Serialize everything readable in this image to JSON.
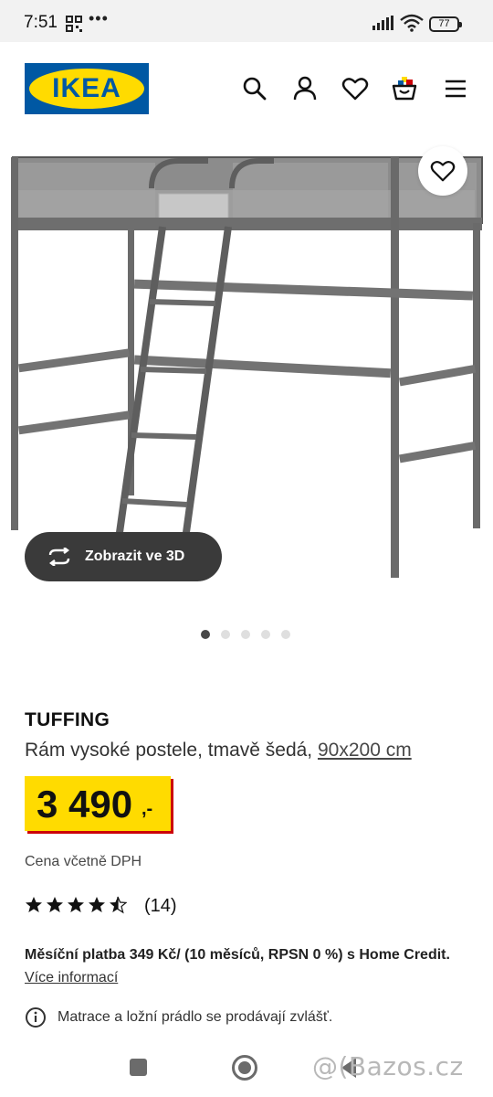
{
  "status_bar": {
    "time": "7:51",
    "battery": "77",
    "icons": [
      "gallery-grid-icon",
      "more-dots-icon",
      "signal-icon",
      "wifi-icon",
      "battery-icon"
    ]
  },
  "header": {
    "logo_text": "IKEA",
    "icons": [
      "search-icon",
      "account-icon",
      "heart-icon",
      "cart-icon",
      "menu-icon"
    ]
  },
  "gallery": {
    "view_3d_label": "Zobrazit ve 3D",
    "total_images": 5,
    "active_index": 0
  },
  "product": {
    "name": "TUFFING",
    "description": "Rám vysoké postele, tmavě šedá, ",
    "size": "90x200 cm",
    "price_int": "3 490",
    "price_dec": ",-",
    "vat_note": "Cena včetně DPH",
    "rating": 4.5,
    "review_count": "(14)",
    "financing_bold": "Měsíční platba 349 Kč/ (10 měsíců, RPSN 0 %) s Home Credit.",
    "financing_link": "Více informací",
    "notice": "Matrace a ložní prádlo se prodávají zvlášť."
  },
  "watermark": "@(Bazos.cz",
  "colors": {
    "ikea_blue": "#0058a3",
    "ikea_yellow": "#ffdb00",
    "price_shadow_red": "#cc0008",
    "dark_button": "#3a3a3a"
  }
}
